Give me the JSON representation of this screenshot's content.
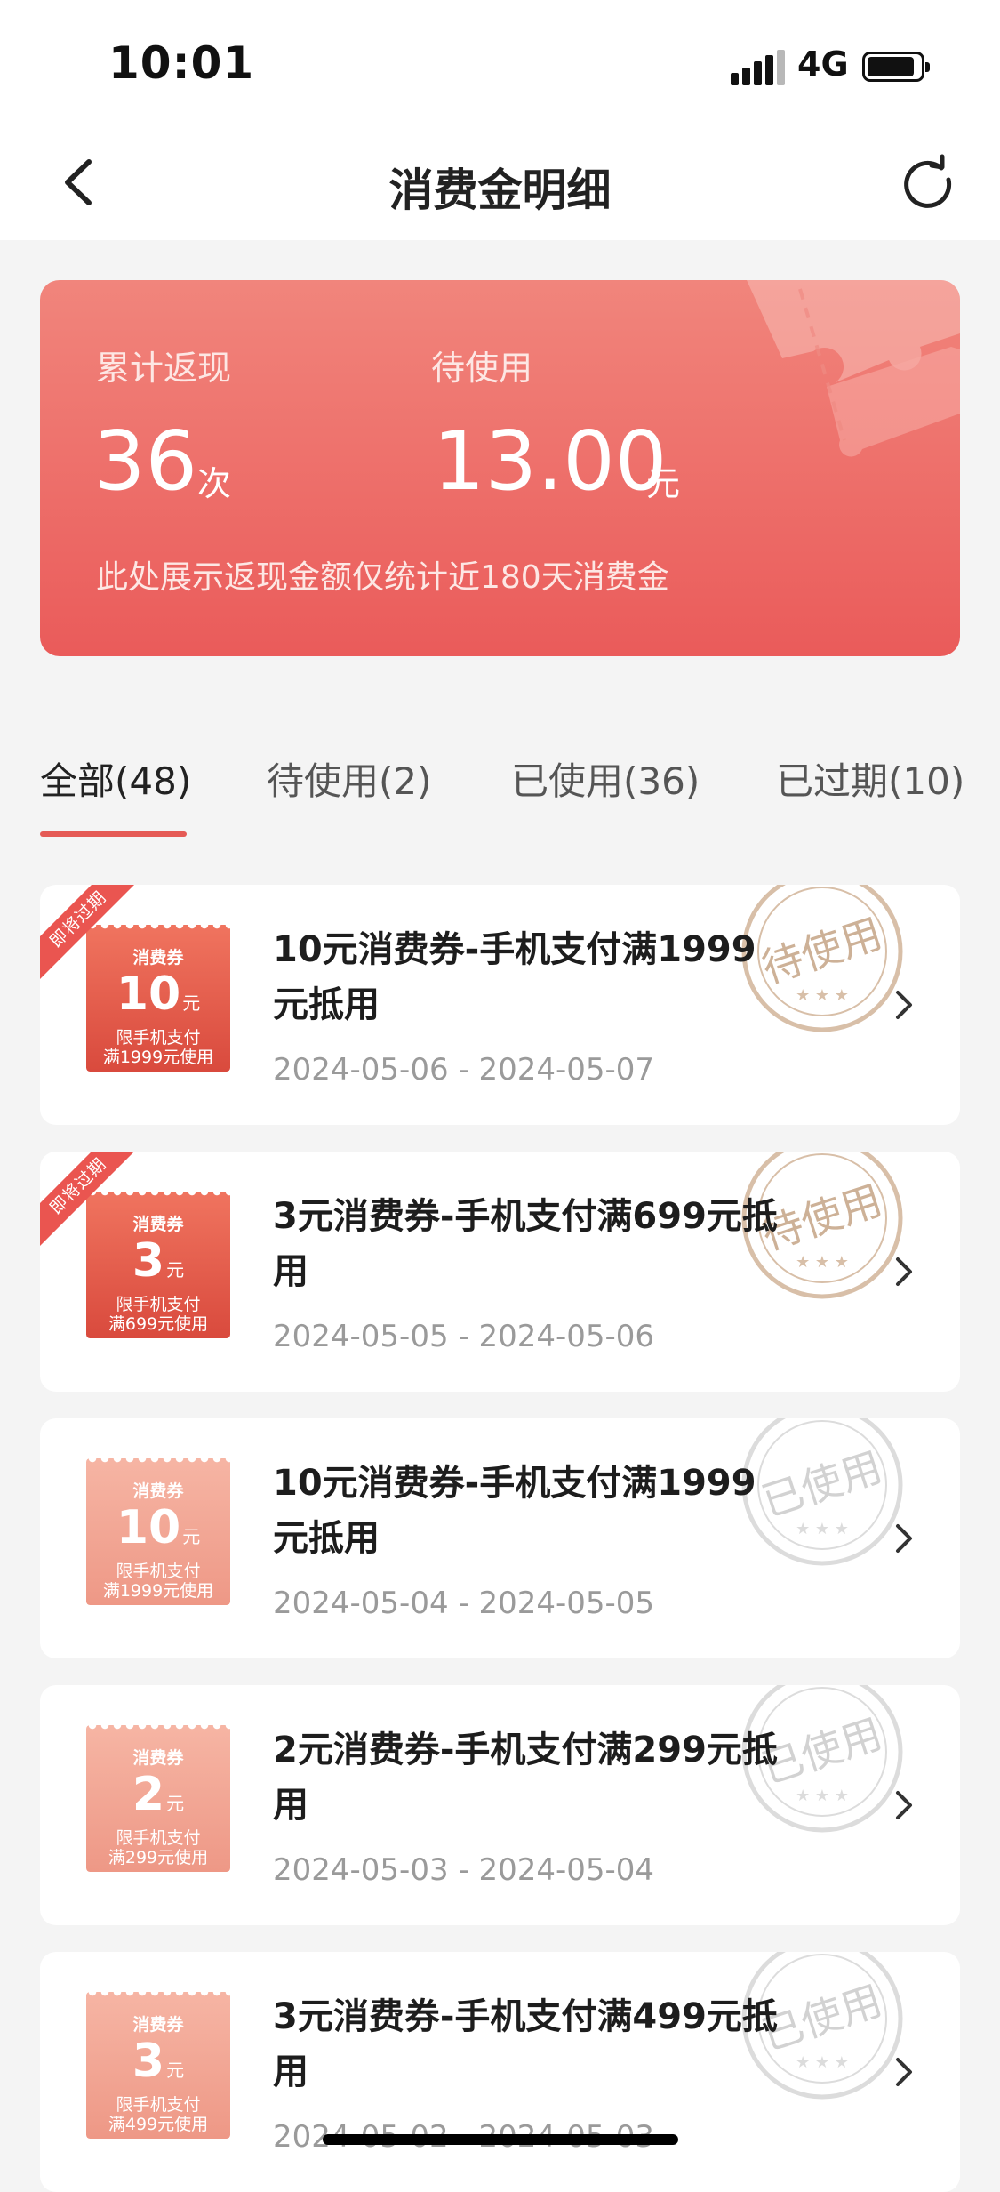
{
  "status_bar": {
    "time": "10:01",
    "network": "4G"
  },
  "nav": {
    "title": "消费金明细"
  },
  "summary": {
    "cashback_label": "累计返现",
    "cashback_value": "36",
    "cashback_unit": "次",
    "pending_label": "待使用",
    "pending_value": "13.00",
    "pending_unit": "元",
    "note": "此处展示返现金额仅统计近180天消费金"
  },
  "tabs": [
    {
      "label": "全部(48)",
      "active": true
    },
    {
      "label": "待使用(2)",
      "active": false
    },
    {
      "label": "已使用(36)",
      "active": false
    },
    {
      "label": "已过期(10)",
      "active": false
    }
  ],
  "coupons": [
    {
      "ribbon": "即将过期",
      "thumb_label": "消费券",
      "thumb_amount": "10",
      "thumb_unit": "元",
      "thumb_cond1": "限手机支付",
      "thumb_cond2": "满1999元使用",
      "title": "10元消费券-手机支付满1999元抵用",
      "date": "2024-05-06 - 2024-05-07",
      "stamp": "待使用",
      "state": "pending"
    },
    {
      "ribbon": "即将过期",
      "thumb_label": "消费券",
      "thumb_amount": "3",
      "thumb_unit": "元",
      "thumb_cond1": "限手机支付",
      "thumb_cond2": "满699元使用",
      "title": "3元消费券-手机支付满699元抵用",
      "date": "2024-05-05 - 2024-05-06",
      "stamp": "待使用",
      "state": "pending"
    },
    {
      "ribbon": "",
      "thumb_label": "消费券",
      "thumb_amount": "10",
      "thumb_unit": "元",
      "thumb_cond1": "限手机支付",
      "thumb_cond2": "满1999元使用",
      "title": "10元消费券-手机支付满1999元抵用",
      "date": "2024-05-04 - 2024-05-05",
      "stamp": "已使用",
      "state": "used"
    },
    {
      "ribbon": "",
      "thumb_label": "消费券",
      "thumb_amount": "2",
      "thumb_unit": "元",
      "thumb_cond1": "限手机支付",
      "thumb_cond2": "满299元使用",
      "title": "2元消费券-手机支付满299元抵用",
      "date": "2024-05-03 - 2024-05-04",
      "stamp": "已使用",
      "state": "used"
    },
    {
      "ribbon": "",
      "thumb_label": "消费券",
      "thumb_amount": "3",
      "thumb_unit": "元",
      "thumb_cond1": "限手机支付",
      "thumb_cond2": "满499元使用",
      "title": "3元消费券-手机支付满499元抵用",
      "date": "2024-05-02 - 2024-05-03",
      "stamp": "已使用",
      "state": "used"
    }
  ],
  "colors": {
    "accent": "#e55a55",
    "card_top": "#f1857c",
    "card_bottom": "#ea5b5a",
    "stamp_pending": "#c8a27e",
    "stamp_used": "#cfcfcf"
  }
}
